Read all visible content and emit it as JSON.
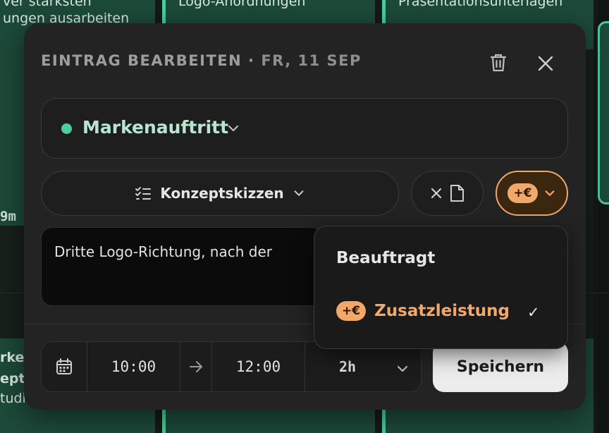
{
  "background": {
    "event_texts": [
      "ver stärksten",
      "ungen ausarbeiten",
      "Logo-Anordnungen",
      "Präsentationsunterlagen",
      "9m",
      "rker",
      "epts",
      "tudie"
    ]
  },
  "modal": {
    "title": "EINTRAG BEARBEITEN",
    "title_separator": " · ",
    "date": "FR, 11 SEP",
    "delete_icon": "trash-icon",
    "close_icon": "close-icon",
    "project": {
      "name": "Markenauftritt",
      "color": "#4ccf9c"
    },
    "task": {
      "label": "Konzeptskizzen",
      "icon": "checklist-icon"
    },
    "billing": {
      "badge": "+€",
      "border_color": "#f0a868"
    },
    "note": {
      "text": "Dritte Logo-Richtung, nach der"
    },
    "time": {
      "start": "10:00",
      "end": "12:00",
      "duration": "2h"
    },
    "save_label": "Speichern"
  },
  "dropdown": {
    "items": [
      {
        "label": "Beauftragt"
      },
      {
        "label": "Zusatzleistung",
        "badge": "+€",
        "checkmark": "✓"
      }
    ],
    "accent_color": "#f1a86a"
  }
}
